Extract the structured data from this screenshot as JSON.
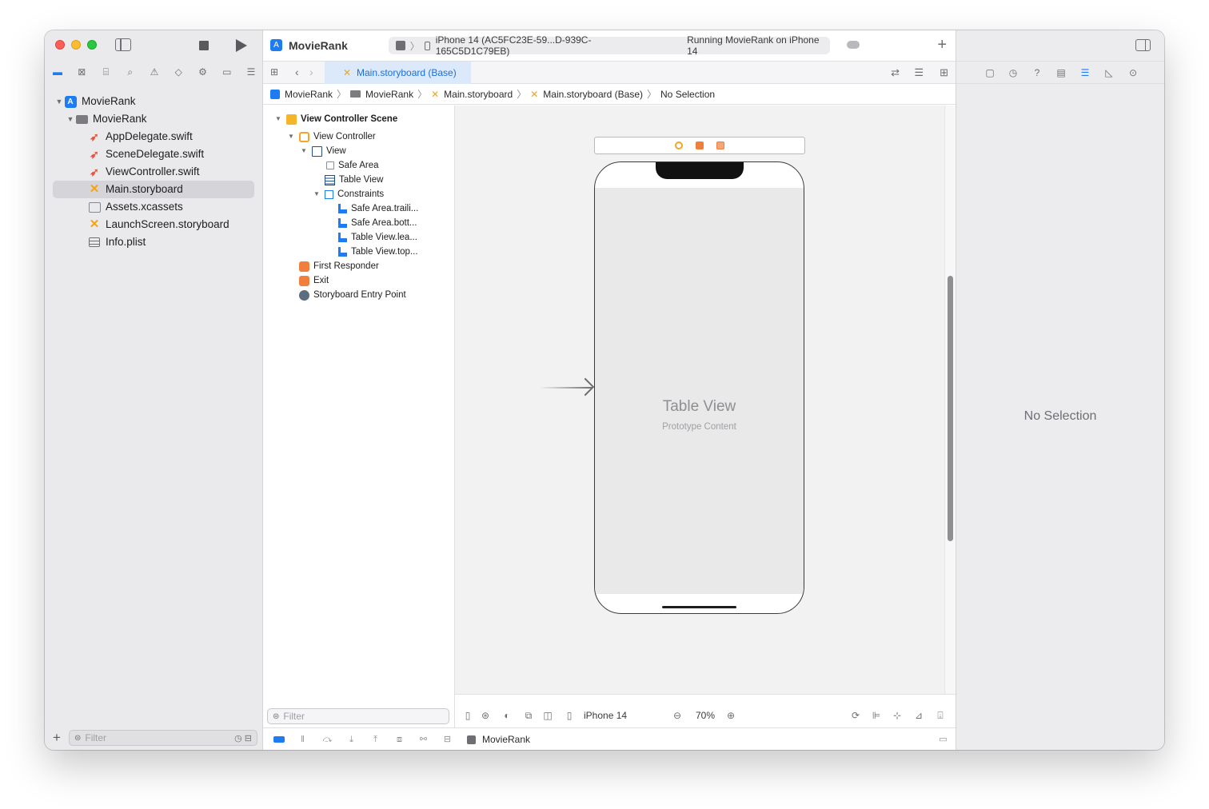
{
  "sidebar": {
    "project_name": "MovieRank",
    "folder_name": "MovieRank",
    "files": [
      {
        "name": "AppDelegate.swift",
        "icon": "swift-icon"
      },
      {
        "name": "SceneDelegate.swift",
        "icon": "swift-icon"
      },
      {
        "name": "ViewController.swift",
        "icon": "swift-icon"
      },
      {
        "name": "Main.storyboard",
        "icon": "storyboard-icon",
        "selected": true
      },
      {
        "name": "Assets.xcassets",
        "icon": "assets-icon"
      },
      {
        "name": "LaunchScreen.storyboard",
        "icon": "storyboard-icon"
      },
      {
        "name": "Info.plist",
        "icon": "plist-icon"
      }
    ],
    "filter_placeholder": "Filter"
  },
  "toolbar": {
    "app_title": "MovieRank",
    "destination": "iPhone 14 (AC5FC23E-59...D-939C-165C5D1C79EB)",
    "status": "Running MovieRank on iPhone 14"
  },
  "tabs": {
    "active_tab": "Main.storyboard (Base)"
  },
  "breadcrumb": {
    "items": [
      "MovieRank",
      "MovieRank",
      "Main.storyboard",
      "Main.storyboard (Base)",
      "No Selection"
    ]
  },
  "outline": {
    "scene": "View Controller Scene",
    "view_controller": "View Controller",
    "view": "View",
    "safe_area": "Safe Area",
    "table_view": "Table View",
    "constraints": "Constraints",
    "constraint_items": [
      "Safe Area.traili...",
      "Safe Area.bott...",
      "Table View.lea...",
      "Table View.top..."
    ],
    "first_responder": "First Responder",
    "exit": "Exit",
    "entry_point": "Storyboard Entry Point",
    "filter_placeholder": "Filter"
  },
  "canvas": {
    "table_view_title": "Table View",
    "table_view_subtitle": "Prototype Content",
    "device": "iPhone 14",
    "zoom": "70%"
  },
  "debug": {
    "target": "MovieRank"
  },
  "inspector": {
    "empty_label": "No Selection"
  },
  "colors": {
    "accent": "#1d7cf2",
    "storyboard": "#f3a419",
    "swift": "#f05138"
  }
}
